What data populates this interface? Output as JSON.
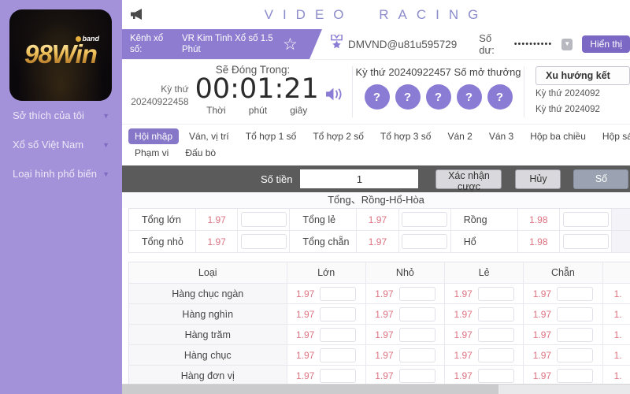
{
  "colors": {
    "accent": "#8a7cd4",
    "sidebar": "#a392d9",
    "odds": "#dd7383",
    "dark_bar": "#5b5b5b"
  },
  "brand": {
    "logo_text": "98Win",
    "logo_badge": "band"
  },
  "sidebar": {
    "items": [
      "Sở thích của tôi",
      "Xổ số Việt Nam",
      "Loại hình phổ biến"
    ]
  },
  "header": {
    "title": "VIDEO RACING",
    "channel_label": "Kênh xổ số:",
    "channel_name": "VR Kim Tinh Xổ số 1.5 Phút",
    "username": "DMVND@u81u595729",
    "balance_label": "Số dư:",
    "balance_masked": "••••••••••",
    "show_button": "Hiển thị"
  },
  "countdown": {
    "closing_label": "Sẽ Đóng Trong:",
    "period_label": "Kỳ thứ",
    "period_number": "20240922458",
    "time": "00:01:21",
    "unit_hour": "Thời",
    "unit_minute": "phút",
    "unit_second": "giây"
  },
  "result": {
    "period_text": "Kỳ thứ 20240922457",
    "label": "Số mở thưởng",
    "balls": [
      "?",
      "?",
      "?",
      "?",
      "?"
    ]
  },
  "trend": {
    "header": "Xu hướng kết",
    "rows": [
      "Kỳ thứ 2024092",
      "Kỳ thứ 2024092"
    ]
  },
  "tabs": {
    "row1": [
      "Hội nhập",
      "Ván, vị trí",
      "Tổ hợp 1 số",
      "Tổ hợp 2 số",
      "Tổ hợp 3 số",
      "Ván 2",
      "Ván 3",
      "Hộp ba chiều",
      "Hộp sáu chiều"
    ],
    "row2": [
      "Phạm vi",
      "Đấu bò"
    ],
    "active": "Hội nhập"
  },
  "bet_bar": {
    "amount_label": "Số tiền",
    "amount_value": "1",
    "confirm": "Xác nhận cược",
    "cancel": "Hủy",
    "number": "Số"
  },
  "sum_section": {
    "title": "Tổng、Rồng-Hổ-Hòa",
    "rows": [
      {
        "cells": [
          {
            "label": "Tổng lớn",
            "odds": "1.97"
          },
          {
            "label": "Tổng lẻ",
            "odds": "1.97"
          },
          {
            "label": "Rồng",
            "odds": "1.98"
          }
        ]
      },
      {
        "cells": [
          {
            "label": "Tổng nhỏ",
            "odds": "1.97"
          },
          {
            "label": "Tổng chẵn",
            "odds": "1.97"
          },
          {
            "label": "Hổ",
            "odds": "1.98"
          }
        ]
      }
    ]
  },
  "digits_table": {
    "headers": [
      "Loại",
      "Lớn",
      "Nhỏ",
      "Lẻ",
      "Chẵn"
    ],
    "rows": [
      {
        "label": "Hàng chục ngàn",
        "odds": [
          "1.97",
          "1.97",
          "1.97",
          "1.97"
        ],
        "partial": "1."
      },
      {
        "label": "Hàng nghìn",
        "odds": [
          "1.97",
          "1.97",
          "1.97",
          "1.97"
        ],
        "partial": "1."
      },
      {
        "label": "Hàng trăm",
        "odds": [
          "1.97",
          "1.97",
          "1.97",
          "1.97"
        ],
        "partial": "1."
      },
      {
        "label": "Hàng chục",
        "odds": [
          "1.97",
          "1.97",
          "1.97",
          "1.97"
        ],
        "partial": "1."
      },
      {
        "label": "Hàng đơn vị",
        "odds": [
          "1.97",
          "1.97",
          "1.97",
          "1.97"
        ],
        "partial": "1."
      }
    ]
  }
}
